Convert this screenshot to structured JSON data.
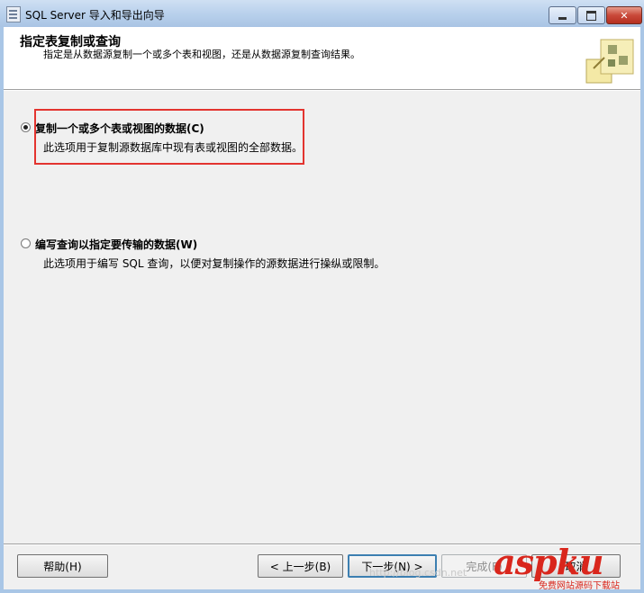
{
  "window": {
    "title": "SQL Server 导入和导出向导",
    "controls": {
      "minimize": "minimize",
      "maximize": "maximize",
      "close": "✕"
    }
  },
  "header": {
    "title": "指定表复制或查询",
    "description": "指定是从数据源复制一个或多个表和视图，还是从数据源复制查询结果。",
    "graphic_icon": "wizard-graphic-icon"
  },
  "options": [
    {
      "label": "复制一个或多个表或视图的数据(C)",
      "description": "此选项用于复制源数据库中现有表或视图的全部数据。",
      "selected": true
    },
    {
      "label": "编写查询以指定要传输的数据(W)",
      "description": "此选项用于编写 SQL 查询，以便对复制操作的源数据进行操纵或限制。",
      "selected": false
    }
  ],
  "buttons": {
    "help": "帮助(H)",
    "back": "< 上一步(B)",
    "next": "下一步(N) >",
    "finish": "完成(F)",
    "cancel": "取消"
  },
  "watermark": {
    "brand": "aspku",
    "subtitle": "免费网站源码下载站",
    "url": "http://blog.csdn.net"
  },
  "colors": {
    "highlight": "#e3342f",
    "watermark": "#d9261c",
    "primary_button_border": "#3c7fb1"
  }
}
